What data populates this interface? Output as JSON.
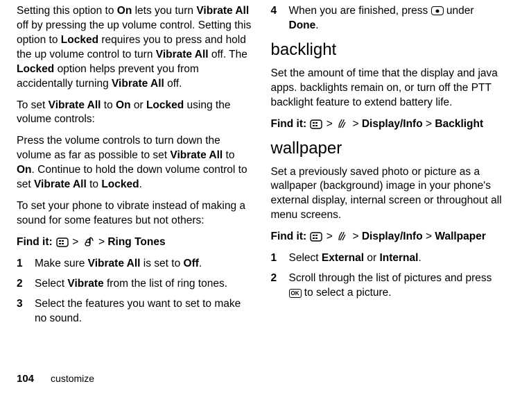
{
  "left": {
    "p1_a": "Setting this option to ",
    "p1_b": " lets you turn ",
    "p1_c": " off by pressing the up volume control. Setting this option to ",
    "p1_d": " requires you to press and hold the up volume control to turn ",
    "p1_e": " off. The ",
    "p1_f": " option helps prevent you from accidentally turning ",
    "p1_g": " off.",
    "p2_a": "To set ",
    "p2_b": " to ",
    "p2_c": " or ",
    "p2_d": " using the volume controls:",
    "p3_a": "Press the volume controls to turn down the volume as far as possible to set ",
    "p3_b": " to ",
    "p3_c": ". Continue to hold the down volume control to set ",
    "p3_d": " to ",
    "p3_e": ".",
    "p4": "To set your phone to vibrate instead of making a sound for some features but not others:",
    "find_lead": "Find it:",
    "find_path_end": "Ring Tones",
    "step1_num": "1",
    "step1_a": "Make sure ",
    "step1_b": " is set to ",
    "step1_c": ".",
    "step2_num": "2",
    "step2_a": "Select ",
    "step2_b": " from the list of ring tones.",
    "step3_num": "3",
    "step3": "Select the features you want to set to make no sound.",
    "terms": {
      "On": "On",
      "VibrateAll": "Vibrate All",
      "Locked": "Locked",
      "Off": "Off",
      "Vibrate": "Vibrate"
    }
  },
  "right": {
    "step4_num": "4",
    "step4_a": "When you are finished, press ",
    "step4_b": " under ",
    "step4_done": "Done",
    "step4_c": ".",
    "h_backlight": "backlight",
    "p_backlight": "Set the amount of time that the display and java apps. backlights remain on, or turn off the PTT backlight feature to extend battery life.",
    "find_lead": "Find it:",
    "find_bl_a": "Display/Info",
    "find_bl_b": "Backlight",
    "h_wallpaper": "wallpaper",
    "p_wallpaper": "Set a previously saved photo or picture as a wallpaper (background) image in your phone's external display, internal screen or throughout all menu screens.",
    "find_wp_a": "Display/Info",
    "find_wp_b": "Wallpaper",
    "step1_num": "1",
    "step1_a": "Select ",
    "step1_ext": "External",
    "step1_or": " or ",
    "step1_int": "Internal",
    "step1_c": ".",
    "step2_num": "2",
    "step2_a": "Scroll through the list of pictures and press ",
    "step2_b": " to select a picture."
  },
  "gt": ">",
  "ok": "OK",
  "footer": {
    "page": "104",
    "section": "customize"
  }
}
